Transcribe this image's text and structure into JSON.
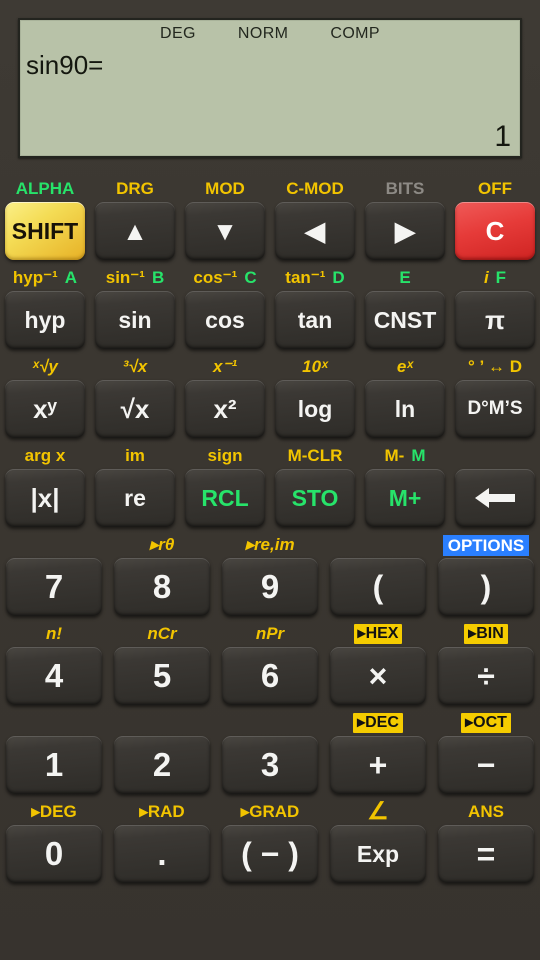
{
  "display": {
    "status": [
      "DEG",
      "NORM",
      "COMP"
    ],
    "entry": "sin90=",
    "result": "1"
  },
  "colors": {
    "shift_label": "#f2c400",
    "alpha_label": "#27e36a",
    "disabled_label": "#8d8a85",
    "badge_bg": "#f5cc00",
    "options_bg": "#2a7fff",
    "clear_key": "#e63b39",
    "shift_key": "#f4dc55",
    "lcd_bg": "#b8c2a8",
    "body_bg": "#3b3731"
  },
  "keypad": {
    "row1": [
      {
        "label": "ALPHA",
        "label_kind": "alpha",
        "key": "SHIFT",
        "key_kind": "shift"
      },
      {
        "label": "DRG",
        "label_kind": "shift",
        "key": "▲",
        "key_kind": "arrow"
      },
      {
        "label": "MOD",
        "label_kind": "shift",
        "key": "▼",
        "key_kind": "arrow"
      },
      {
        "label": "C-MOD",
        "label_kind": "shift",
        "key": "◀",
        "key_kind": "arrow"
      },
      {
        "label": "BITS",
        "label_kind": "dim",
        "key": "▶",
        "key_kind": "arrow"
      },
      {
        "label": "OFF",
        "label_kind": "shift",
        "key": "C",
        "key_kind": "clear"
      }
    ],
    "row2": [
      {
        "shift": "hyp⁻¹",
        "alpha": "",
        "key": "hyp"
      },
      {
        "shift": "sin⁻¹",
        "alpha": "A",
        "key": "sin"
      },
      {
        "shift": "cos⁻¹",
        "alpha": "B",
        "key": "cos"
      },
      {
        "shift": "tan⁻¹",
        "alpha": "C",
        "key": "tan"
      },
      {
        "shift": "",
        "alpha": "D",
        "key": "CNST",
        "alpha_e": "E"
      },
      {
        "shift": "i",
        "alpha": "F",
        "key": "π"
      }
    ],
    "row2_labels": [
      "hyp⁻¹",
      "A",
      "sin⁻¹",
      "B",
      "cos⁻¹",
      "C",
      "tan⁻¹",
      "D",
      "E",
      "i",
      "F"
    ],
    "row3": [
      {
        "shift": "ˣ√y",
        "key": "x^y",
        "key_text": "xʸ"
      },
      {
        "shift": "³√x",
        "key": "sqrt",
        "key_text": "√x"
      },
      {
        "shift": "x⁻¹",
        "key": "x2",
        "key_text": "x²"
      },
      {
        "shift": "10ˣ",
        "key": "log",
        "key_text": "log"
      },
      {
        "shift": "eˣ",
        "key": "ln",
        "key_text": "ln"
      },
      {
        "shift": "° ’ ↔ D",
        "key": "dms",
        "key_text": "D°M’S"
      }
    ],
    "row4": [
      {
        "shift": "arg x",
        "alpha": "",
        "key": "|x|",
        "key_kind": "plain"
      },
      {
        "shift": "im",
        "alpha": "",
        "key": "re",
        "key_kind": "plain"
      },
      {
        "shift": "sign",
        "alpha": "",
        "key": "RCL",
        "key_kind": "green"
      },
      {
        "shift": "M-CLR",
        "alpha": "",
        "key": "STO",
        "key_kind": "green"
      },
      {
        "shift": "M-",
        "alpha": "M",
        "key": "M+",
        "key_kind": "green"
      },
      {
        "shift": "",
        "alpha": "",
        "key": "⬅",
        "key_kind": "backspace"
      }
    ],
    "row5": [
      {
        "label": "",
        "label_kind": "shift",
        "key": "7"
      },
      {
        "label": "▸rθ",
        "label_kind": "shift",
        "key": "8"
      },
      {
        "label": "▸re,im",
        "label_kind": "shift",
        "key": "9"
      },
      {
        "label": "",
        "label_kind": "shift",
        "key": "("
      },
      {
        "label": "OPTIONS",
        "label_kind": "options",
        "key": ")"
      }
    ],
    "row6": [
      {
        "label": "n!",
        "label_kind": "shift",
        "key": "4"
      },
      {
        "label": "nCr",
        "label_kind": "shift",
        "key": "5"
      },
      {
        "label": "nPr",
        "label_kind": "shift",
        "key": "6"
      },
      {
        "label": "▸HEX",
        "label_kind": "badge",
        "key": "×"
      },
      {
        "label": "▸BIN",
        "label_kind": "badge",
        "key": "÷"
      }
    ],
    "row7": [
      {
        "label": "",
        "label_kind": "shift",
        "key": "1"
      },
      {
        "label": "",
        "label_kind": "shift",
        "key": "2"
      },
      {
        "label": "",
        "label_kind": "shift",
        "key": "3"
      },
      {
        "label": "▸DEC",
        "label_kind": "badge",
        "key": "+"
      },
      {
        "label": "▸OCT",
        "label_kind": "badge",
        "key": "−"
      }
    ],
    "row8": [
      {
        "label": "▸DEG",
        "label_kind": "shift",
        "key": "0"
      },
      {
        "label": "▸RAD",
        "label_kind": "shift",
        "key": "."
      },
      {
        "label": "▸GRAD",
        "label_kind": "shift",
        "key": "( − )"
      },
      {
        "label": "∠",
        "label_kind": "shift",
        "key": "Exp"
      },
      {
        "label": "ANS",
        "label_kind": "shift",
        "key": "="
      }
    ]
  }
}
